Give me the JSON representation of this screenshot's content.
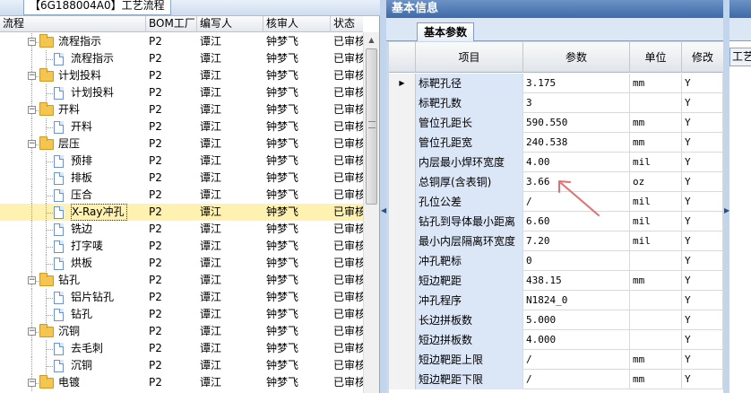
{
  "left_panel": {
    "tab_label": "【6G188004A0】工艺流程",
    "columns": [
      "流程",
      "BOM工厂",
      "编写人",
      "核审人",
      "状态"
    ],
    "rows": [
      {
        "level": 0,
        "type": "folder",
        "name": "流程指示",
        "bom": "P2",
        "writer": "谭江",
        "reviewer": "钟梦飞",
        "status": "已审核",
        "selected": false
      },
      {
        "level": 1,
        "type": "doc",
        "name": "流程指示",
        "bom": "P2",
        "writer": "谭江",
        "reviewer": "钟梦飞",
        "status": "已审核",
        "selected": false
      },
      {
        "level": 0,
        "type": "folder",
        "name": "计划投料",
        "bom": "P2",
        "writer": "谭江",
        "reviewer": "钟梦飞",
        "status": "已审核",
        "selected": false
      },
      {
        "level": 1,
        "type": "doc",
        "name": "计划投料",
        "bom": "P2",
        "writer": "谭江",
        "reviewer": "钟梦飞",
        "status": "已审核",
        "selected": false
      },
      {
        "level": 0,
        "type": "folder",
        "name": "开料",
        "bom": "P2",
        "writer": "谭江",
        "reviewer": "钟梦飞",
        "status": "已审核",
        "selected": false
      },
      {
        "level": 1,
        "type": "doc",
        "name": "开料",
        "bom": "P2",
        "writer": "谭江",
        "reviewer": "钟梦飞",
        "status": "已审核",
        "selected": false
      },
      {
        "level": 0,
        "type": "folder",
        "name": "层压",
        "bom": "P2",
        "writer": "谭江",
        "reviewer": "钟梦飞",
        "status": "已审核",
        "selected": false
      },
      {
        "level": 1,
        "type": "doc",
        "name": "预排",
        "bom": "P2",
        "writer": "谭江",
        "reviewer": "钟梦飞",
        "status": "已审核",
        "selected": false
      },
      {
        "level": 1,
        "type": "doc",
        "name": "排板",
        "bom": "P2",
        "writer": "谭江",
        "reviewer": "钟梦飞",
        "status": "已审核",
        "selected": false
      },
      {
        "level": 1,
        "type": "doc",
        "name": "压合",
        "bom": "P2",
        "writer": "谭江",
        "reviewer": "钟梦飞",
        "status": "已审核",
        "selected": false
      },
      {
        "level": 1,
        "type": "doc",
        "name": "X-Ray冲孔",
        "bom": "P2",
        "writer": "谭江",
        "reviewer": "钟梦飞",
        "status": "已审核",
        "selected": true
      },
      {
        "level": 1,
        "type": "doc",
        "name": "铣边",
        "bom": "P2",
        "writer": "谭江",
        "reviewer": "钟梦飞",
        "status": "已审核",
        "selected": false
      },
      {
        "level": 1,
        "type": "doc",
        "name": "打字唛",
        "bom": "P2",
        "writer": "谭江",
        "reviewer": "钟梦飞",
        "status": "已审核",
        "selected": false
      },
      {
        "level": 1,
        "type": "doc",
        "name": "烘板",
        "bom": "P2",
        "writer": "谭江",
        "reviewer": "钟梦飞",
        "status": "已审核",
        "selected": false
      },
      {
        "level": 0,
        "type": "folder",
        "name": "钻孔",
        "bom": "P2",
        "writer": "谭江",
        "reviewer": "钟梦飞",
        "status": "已审核",
        "selected": false
      },
      {
        "level": 1,
        "type": "doc",
        "name": "铝片钻孔",
        "bom": "P2",
        "writer": "谭江",
        "reviewer": "钟梦飞",
        "status": "已审核",
        "selected": false
      },
      {
        "level": 1,
        "type": "doc",
        "name": "钻孔",
        "bom": "P2",
        "writer": "谭江",
        "reviewer": "钟梦飞",
        "status": "已审核",
        "selected": false
      },
      {
        "level": 0,
        "type": "folder",
        "name": "沉铜",
        "bom": "P2",
        "writer": "谭江",
        "reviewer": "钟梦飞",
        "status": "已审核",
        "selected": false
      },
      {
        "level": 1,
        "type": "doc",
        "name": "去毛刺",
        "bom": "P2",
        "writer": "谭江",
        "reviewer": "钟梦飞",
        "status": "已审核",
        "selected": false
      },
      {
        "level": 1,
        "type": "doc",
        "name": "沉铜",
        "bom": "P2",
        "writer": "谭江",
        "reviewer": "钟梦飞",
        "status": "已审核",
        "selected": false
      },
      {
        "level": 0,
        "type": "folder",
        "name": "电镀",
        "bom": "P2",
        "writer": "谭江",
        "reviewer": "钟梦飞",
        "status": "已审核",
        "selected": false
      }
    ]
  },
  "right_panel": {
    "title": "基本信息",
    "tab_label": "基本参数",
    "columns": [
      "项目",
      "参数",
      "单位",
      "修改"
    ],
    "rows": [
      {
        "name": "标靶孔径",
        "value": "3.175",
        "unit": "mm",
        "modify": "Y",
        "current": true
      },
      {
        "name": "标靶孔数",
        "value": "3",
        "unit": "",
        "modify": "Y",
        "current": false
      },
      {
        "name": "管位孔距长",
        "value": "590.550",
        "unit": "mm",
        "modify": "Y",
        "current": false
      },
      {
        "name": "管位孔距宽",
        "value": "240.538",
        "unit": "mm",
        "modify": "Y",
        "current": false
      },
      {
        "name": "内层最小焊环宽度",
        "value": "4.00",
        "unit": "mil",
        "modify": "Y",
        "current": false
      },
      {
        "name": "总铜厚(含表铜)",
        "value": "3.66",
        "unit": "oz",
        "modify": "Y",
        "current": false
      },
      {
        "name": "孔位公差",
        "value": "/",
        "unit": "mil",
        "modify": "Y",
        "current": false
      },
      {
        "name": "钻孔到导体最小距离",
        "value": "6.60",
        "unit": "mil",
        "modify": "Y",
        "current": false
      },
      {
        "name": "最小内层隔离环宽度",
        "value": "7.20",
        "unit": "mil",
        "modify": "Y",
        "current": false
      },
      {
        "name": "冲孔靶标",
        "value": "0",
        "unit": "",
        "modify": "Y",
        "current": false
      },
      {
        "name": "短边靶距",
        "value": "438.15",
        "unit": "mm",
        "modify": "Y",
        "current": false
      },
      {
        "name": "冲孔程序",
        "value": "N1824_0",
        "unit": "",
        "modify": "Y",
        "current": false
      },
      {
        "name": "长边拼板数",
        "value": "5.000",
        "unit": "",
        "modify": "Y",
        "current": false
      },
      {
        "name": "短边拼板数",
        "value": "4.000",
        "unit": "",
        "modify": "Y",
        "current": false
      },
      {
        "name": "短边靶距上限",
        "value": "/",
        "unit": "mm",
        "modify": "Y",
        "current": false
      },
      {
        "name": "短边靶距下限",
        "value": "/",
        "unit": "mm",
        "modify": "Y",
        "current": false
      }
    ]
  },
  "far_right_panel": {
    "tab_label": "工艺"
  },
  "colors": {
    "header_blue": "#3f6aa8",
    "selected_row": "#fff2b0",
    "name_cell": "#dbe6f7",
    "annotation_arrow": "#e07070"
  },
  "icons": {
    "folder": "folder-icon",
    "doc": "document-icon",
    "row_pointer": "row-pointer-icon",
    "annotation": "annotation-arrow-icon"
  }
}
